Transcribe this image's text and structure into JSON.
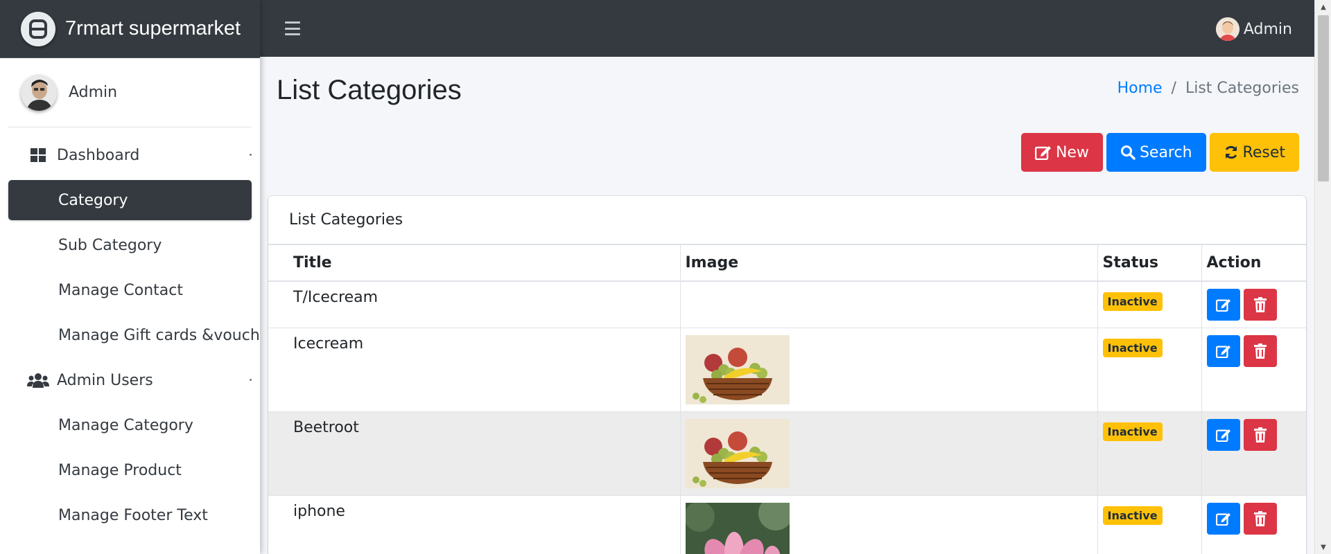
{
  "brand": {
    "name": "7rmart supermarket"
  },
  "sidebar": {
    "user_name": "Admin",
    "items": [
      {
        "label": "Dashboard",
        "icon": "th-large-icon"
      },
      {
        "label": "Category"
      },
      {
        "label": "Sub Category"
      },
      {
        "label": "Manage Contact"
      },
      {
        "label": "Manage Gift cards &voucher"
      },
      {
        "label": "Admin Users",
        "icon": "users-icon"
      },
      {
        "label": "Manage Category"
      },
      {
        "label": "Manage Product"
      },
      {
        "label": "Manage Footer Text"
      }
    ],
    "active": "Category"
  },
  "topbar": {
    "user_name": "Admin"
  },
  "page": {
    "title": "List Categories",
    "breadcrumb": {
      "home": "Home",
      "separator": "/",
      "current": "List Categories"
    }
  },
  "buttons": {
    "new": "New",
    "search": "Search",
    "reset": "Reset"
  },
  "card": {
    "header": "List Categories",
    "columns": [
      "Title",
      "Image",
      "Status",
      "Action"
    ],
    "rows": [
      {
        "title": "T/Icecream",
        "image": "",
        "status": "Inactive"
      },
      {
        "title": "Icecream",
        "image": "fruit-basket",
        "status": "Inactive"
      },
      {
        "title": "Beetroot",
        "image": "fruit-basket",
        "status": "Inactive"
      },
      {
        "title": "iphone",
        "image": "lotus-flower",
        "status": "Inactive"
      }
    ]
  },
  "colors": {
    "dark": "#343a40",
    "primary": "#007bff",
    "danger": "#dc3545",
    "warning": "#ffc107"
  }
}
